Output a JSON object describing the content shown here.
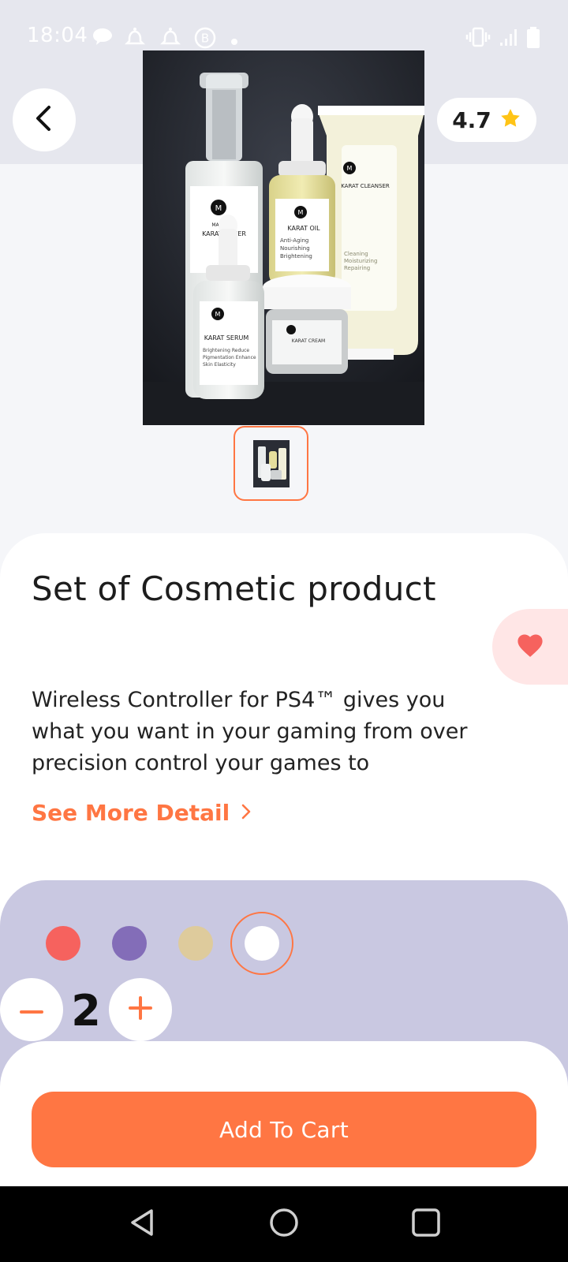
{
  "status_bar": {
    "time": "18:04",
    "left_icons": [
      "chat-bubble-icon",
      "notification-icon",
      "notification-icon",
      "b-badge-icon",
      "dot-icon"
    ],
    "right_icons": [
      "vibrate-icon",
      "signal-icon",
      "battery-icon"
    ]
  },
  "header": {
    "back_icon": "chevron-left-icon",
    "rating": "4.7",
    "rating_icon": "star-icon"
  },
  "product": {
    "photo_labels": {
      "brand": "MARASA",
      "toner": "KARAT TONER",
      "oil": "KARAT OIL",
      "oil_sub": "Anti-Aging Nourishing Brightening",
      "cleanser": "KARAT CLEANSER",
      "cleanser_sub": "Cleaning Moisturizing Repairing",
      "serum": "KARAT SERUM",
      "serum_sub": "Brightening Reduce Pigmentation Enhance Skin Elasticity",
      "cream": "KARAT CREAM"
    },
    "title": "Set of Cosmetic product",
    "description": "Wireless Controller for PS4™ gives you what you want in your gaming from over precision control your games to",
    "see_more": "See More Detail",
    "favorite_icon": "heart-icon",
    "favorite": true
  },
  "options": {
    "colors": [
      "#F6625E",
      "#836DB8",
      "#DECB9C",
      "#FFFFFF"
    ],
    "selected_color_index": 3,
    "quantity": "2",
    "minus_icon": "minus-icon",
    "plus_icon": "plus-icon"
  },
  "cart": {
    "button_label": "Add To Cart"
  },
  "theme": {
    "accent": "#FF7643",
    "favorite_bg": "#FFE6E6",
    "favorite_heart": "#F6625E",
    "options_bg": "#C9C8E1"
  },
  "nav_bar": {
    "icons": [
      "back-triangle-icon",
      "home-circle-icon",
      "recents-square-icon"
    ]
  }
}
